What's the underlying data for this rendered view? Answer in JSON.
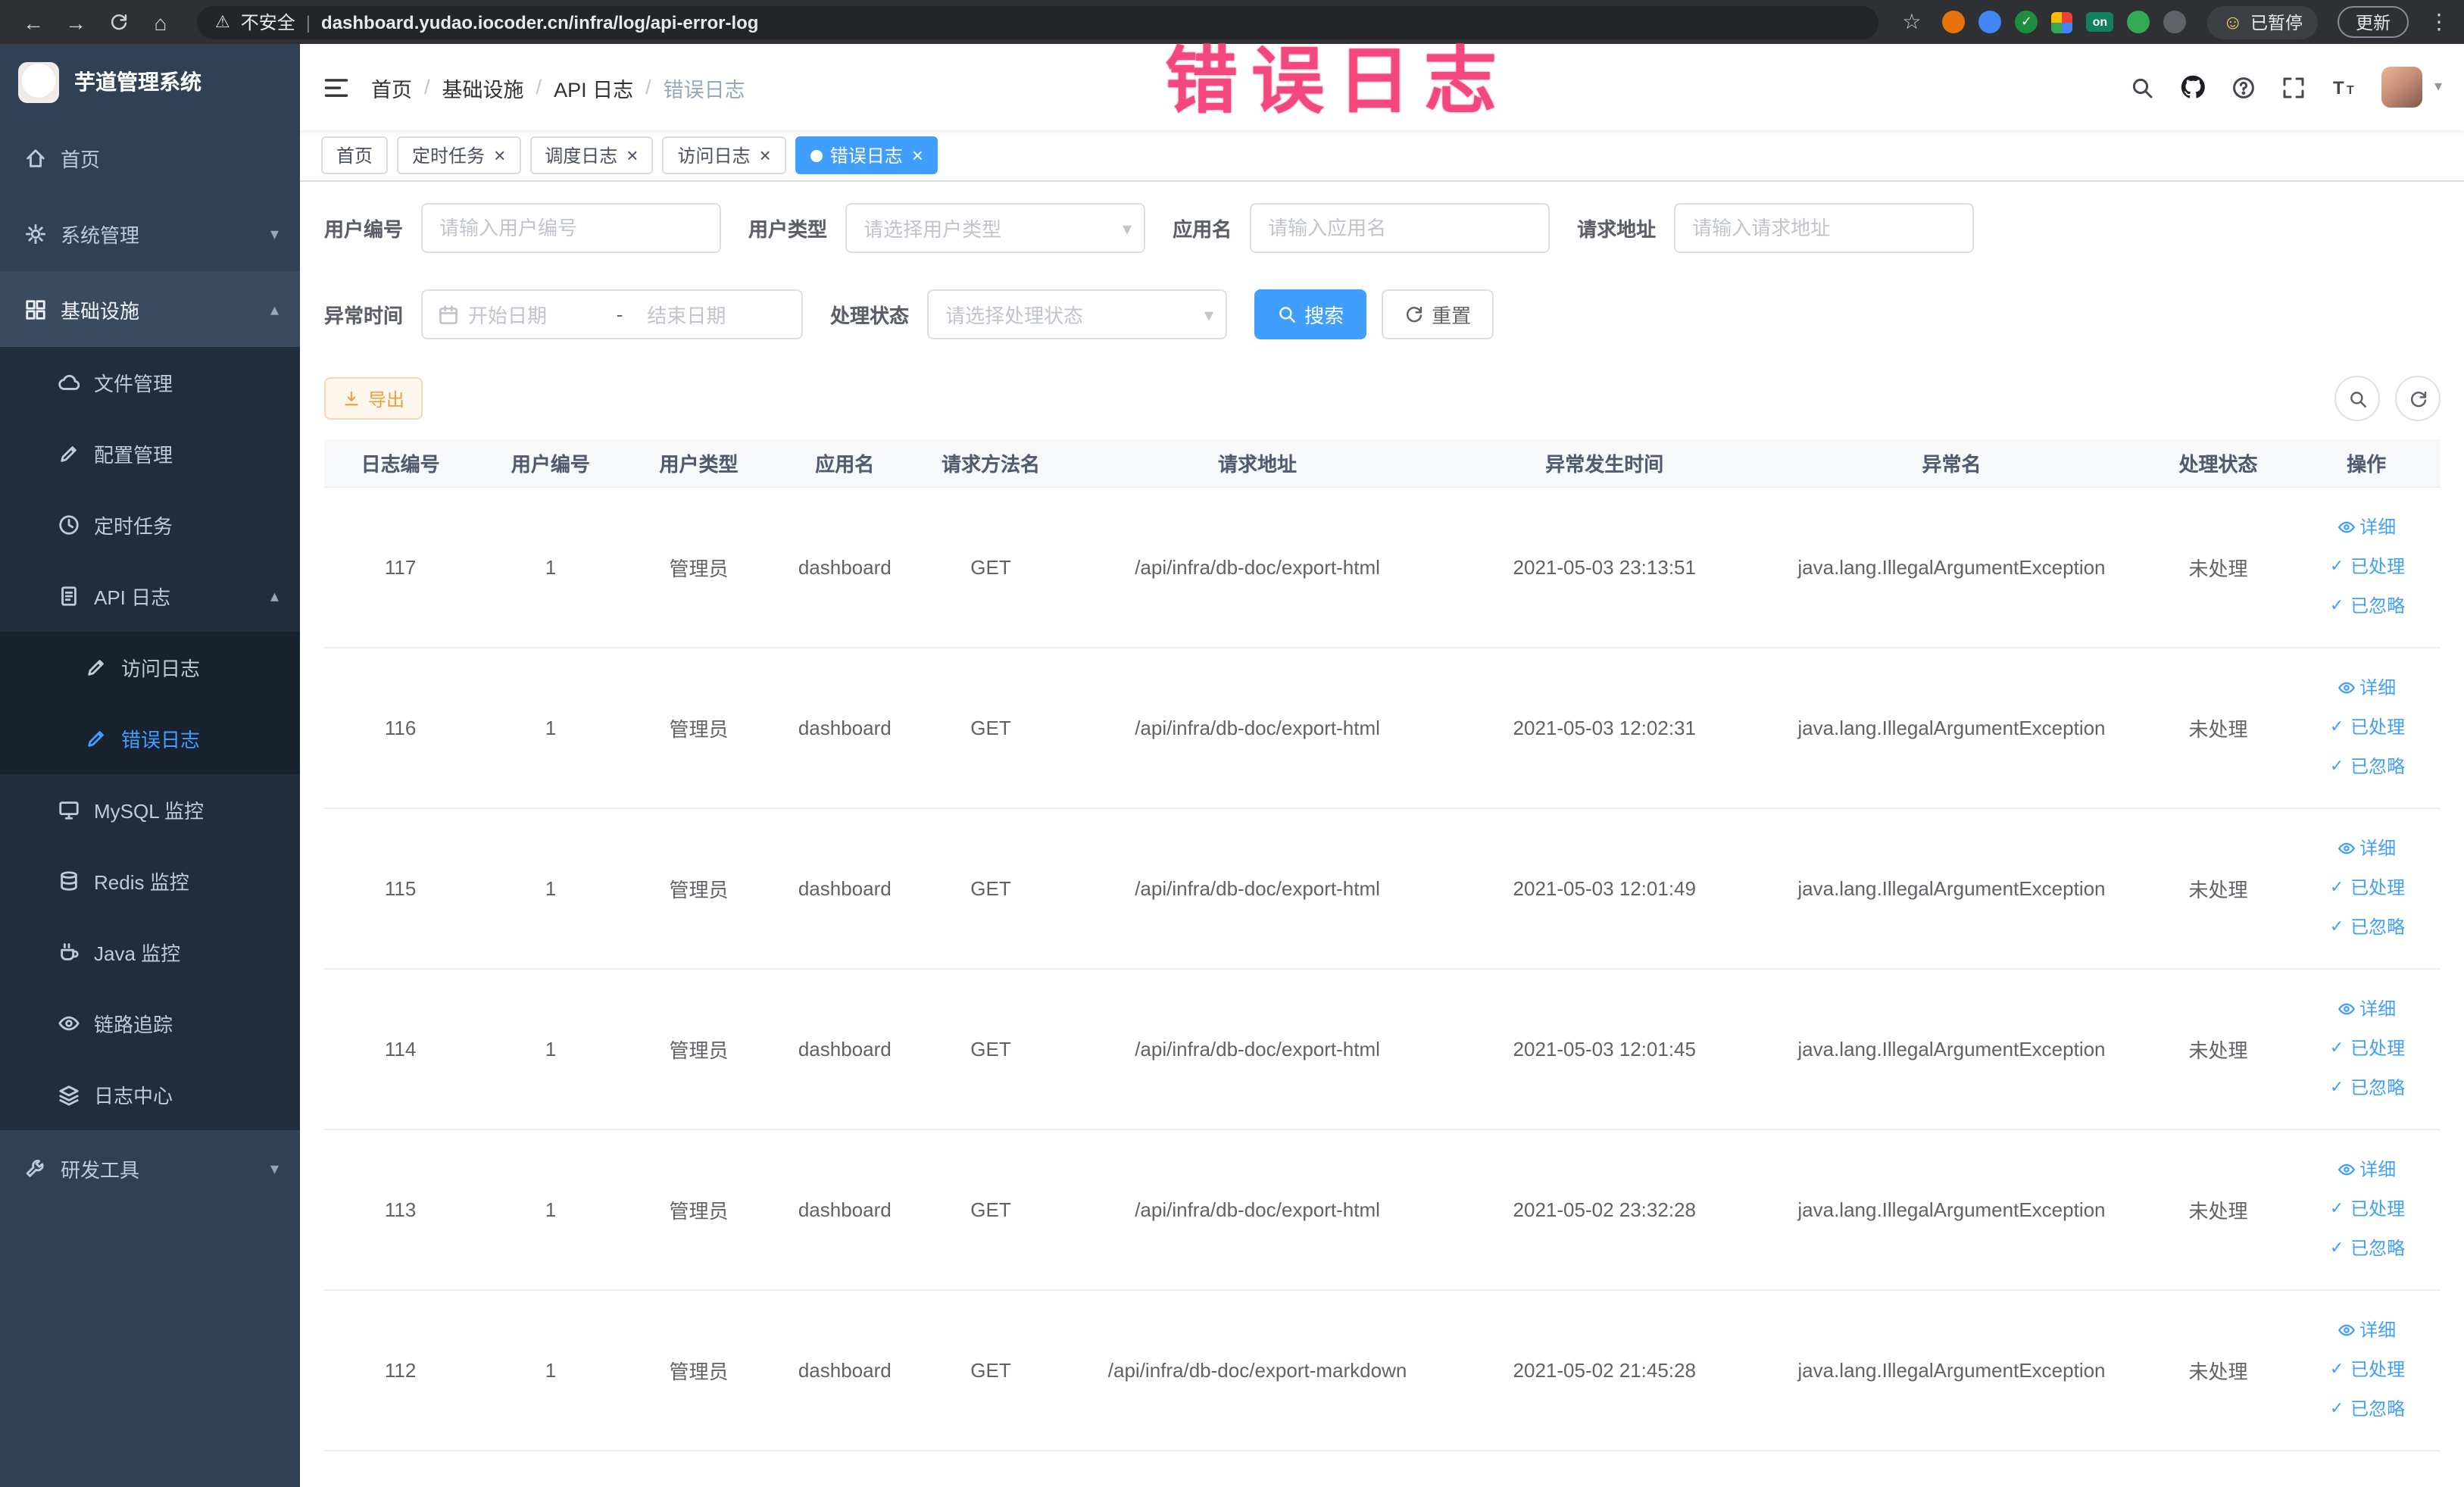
{
  "browser": {
    "back_icon": "←",
    "forward_icon": "→",
    "home_icon": "⌂",
    "warning_icon": "⚠",
    "security_label": "不安全",
    "url_separator": "|",
    "url": "dashboard.yudao.iocoder.cn/infra/log/api-error-log",
    "bookmark_icon": "☆",
    "profile_icon": "☺",
    "profile_label": "已暂停",
    "update_label": "更新",
    "menu_icon": "⋮",
    "extensions": [
      {
        "name": "extension-orange-icon",
        "shape": "circle",
        "color": "#e8710a"
      },
      {
        "name": "extension-blue-icon",
        "shape": "circle",
        "color": "#4285f4"
      },
      {
        "name": "extension-green-check-icon",
        "shape": "circle",
        "color": "#1e8e3e",
        "glyph": "✓"
      },
      {
        "name": "extension-grid-icon",
        "shape": "grid"
      },
      {
        "name": "extension-on-badge",
        "shape": "badge",
        "color": "#12805c",
        "label": "on"
      },
      {
        "name": "extension-leaf-icon",
        "shape": "circle",
        "color": "#34a853"
      },
      {
        "name": "extension-puzzle-icon",
        "shape": "circle",
        "color": "#5f6368"
      }
    ]
  },
  "annotation": {
    "text": "错误日志",
    "color": "#f4487c"
  },
  "sidebar": {
    "logo_title": "芋道管理系统",
    "items": [
      {
        "key": "home",
        "label": "首页",
        "icon": "home-icon",
        "level": 1
      },
      {
        "key": "system",
        "label": "系统管理",
        "icon": "gear-icon",
        "level": 1,
        "chevron": "down"
      },
      {
        "key": "infra",
        "label": "基础设施",
        "icon": "grid-icon",
        "level": 1,
        "chevron": "up",
        "section": true
      },
      {
        "key": "file",
        "label": "文件管理",
        "icon": "cloud-icon",
        "level": 2
      },
      {
        "key": "config",
        "label": "配置管理",
        "icon": "edit-icon",
        "level": 2
      },
      {
        "key": "job",
        "label": "定时任务",
        "icon": "clock-icon",
        "level": 2
      },
      {
        "key": "api-log",
        "label": "API 日志",
        "icon": "doc-icon",
        "level": 2,
        "chevron": "up"
      },
      {
        "key": "access-log",
        "label": "访问日志",
        "icon": "edit-icon",
        "level": 3
      },
      {
        "key": "error-log",
        "label": "错误日志",
        "icon": "edit-icon",
        "level": 3,
        "active": true
      },
      {
        "key": "mysql",
        "label": "MySQL 监控",
        "icon": "monitor-icon",
        "level": 2
      },
      {
        "key": "redis",
        "label": "Redis 监控",
        "icon": "database-icon",
        "level": 2
      },
      {
        "key": "java",
        "label": "Java 监控",
        "icon": "coffee-icon",
        "level": 2
      },
      {
        "key": "trace",
        "label": "链路追踪",
        "icon": "eye-icon",
        "level": 2
      },
      {
        "key": "log-center",
        "label": "日志中心",
        "icon": "layers-icon",
        "level": 2
      },
      {
        "key": "dev-tools",
        "label": "研发工具",
        "icon": "wrench-icon",
        "level": 1,
        "chevron": "down"
      }
    ]
  },
  "header": {
    "breadcrumb": [
      "首页",
      "基础设施",
      "API 日志",
      "错误日志"
    ],
    "breadcrumb_separator": "/"
  },
  "tab_close_icon": "×",
  "tabs": [
    {
      "label": "首页",
      "closable": false,
      "active": false
    },
    {
      "label": "定时任务",
      "closable": true,
      "active": false
    },
    {
      "label": "调度日志",
      "closable": true,
      "active": false
    },
    {
      "label": "访问日志",
      "closable": true,
      "active": false
    },
    {
      "label": "错误日志",
      "closable": true,
      "active": true
    }
  ],
  "filters": {
    "user_id": {
      "label": "用户编号",
      "placeholder": "请输入用户编号"
    },
    "user_type": {
      "label": "用户类型",
      "placeholder": "请选择用户类型"
    },
    "app_name": {
      "label": "应用名",
      "placeholder": "请输入应用名"
    },
    "request_url": {
      "label": "请求地址",
      "placeholder": "请输入请求地址"
    },
    "exception_time": {
      "label": "异常时间",
      "start_placeholder": "开始日期",
      "separator": "-",
      "end_placeholder": "结束日期"
    },
    "process_status": {
      "label": "处理状态",
      "placeholder": "请选择处理状态"
    },
    "search_button": "搜索",
    "reset_button": "重置"
  },
  "toolbar": {
    "export_button": "导出"
  },
  "table": {
    "columns": [
      "日志编号",
      "用户编号",
      "用户类型",
      "应用名",
      "请求方法名",
      "请求地址",
      "异常发生时间",
      "异常名",
      "处理状态",
      "操作"
    ],
    "actions": [
      {
        "key": "detail",
        "label": "详细",
        "icon": "eye-icon"
      },
      {
        "key": "processed",
        "label": "已处理",
        "icon": "check-icon"
      },
      {
        "key": "ignored",
        "label": "已忽略",
        "icon": "check-icon"
      }
    ],
    "rows": [
      {
        "id": "117",
        "user_id": "1",
        "user_type": "管理员",
        "app": "dashboard",
        "method": "GET",
        "url": "/api/infra/db-doc/export-html",
        "time": "2021-05-03 23:13:51",
        "exception": "java.lang.IllegalArgumentException",
        "status": "未处理"
      },
      {
        "id": "116",
        "user_id": "1",
        "user_type": "管理员",
        "app": "dashboard",
        "method": "GET",
        "url": "/api/infra/db-doc/export-html",
        "time": "2021-05-03 12:02:31",
        "exception": "java.lang.IllegalArgumentException",
        "status": "未处理"
      },
      {
        "id": "115",
        "user_id": "1",
        "user_type": "管理员",
        "app": "dashboard",
        "method": "GET",
        "url": "/api/infra/db-doc/export-html",
        "time": "2021-05-03 12:01:49",
        "exception": "java.lang.IllegalArgumentException",
        "status": "未处理"
      },
      {
        "id": "114",
        "user_id": "1",
        "user_type": "管理员",
        "app": "dashboard",
        "method": "GET",
        "url": "/api/infra/db-doc/export-html",
        "time": "2021-05-03 12:01:45",
        "exception": "java.lang.IllegalArgumentException",
        "status": "未处理"
      },
      {
        "id": "113",
        "user_id": "1",
        "user_type": "管理员",
        "app": "dashboard",
        "method": "GET",
        "url": "/api/infra/db-doc/export-html",
        "time": "2021-05-02 23:32:28",
        "exception": "java.lang.IllegalArgumentException",
        "status": "未处理"
      },
      {
        "id": "112",
        "user_id": "1",
        "user_type": "管理员",
        "app": "dashboard",
        "method": "GET",
        "url": "/api/infra/db-doc/export-markdown",
        "time": "2021-05-02 21:45:28",
        "exception": "java.lang.IllegalArgumentException",
        "status": "未处理"
      }
    ]
  }
}
